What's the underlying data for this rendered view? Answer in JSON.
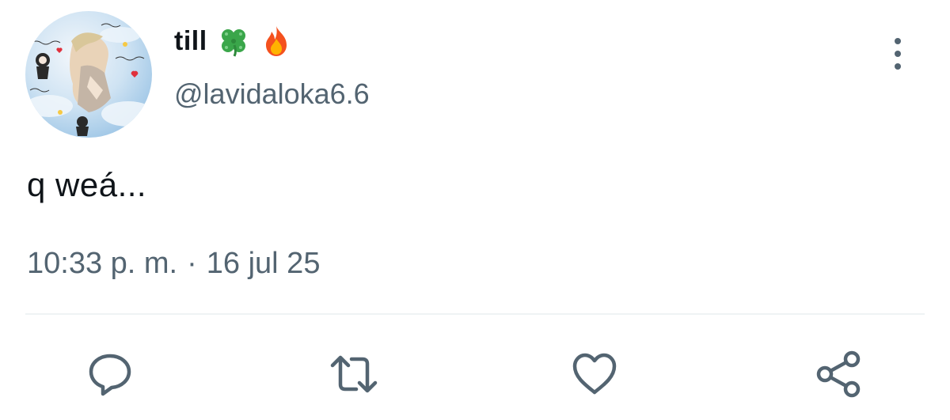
{
  "author": {
    "display_name": "till",
    "name_emojis": [
      "four-leaf-clover",
      "fire"
    ],
    "handle": "@lavidaloka6.6",
    "avatar_description": "avatar"
  },
  "tweet": {
    "text": "q weá...",
    "time": "10:33 p. m.",
    "separator": "·",
    "date": "16 jul 25"
  },
  "actions": {
    "reply_icon": "reply-icon",
    "retweet_icon": "retweet-icon",
    "like_icon": "like-icon",
    "share_icon": "share-icon"
  },
  "colors": {
    "text_primary": "#0f1419",
    "text_secondary": "#536471",
    "divider": "#eff3f4",
    "icon": "#536471"
  }
}
